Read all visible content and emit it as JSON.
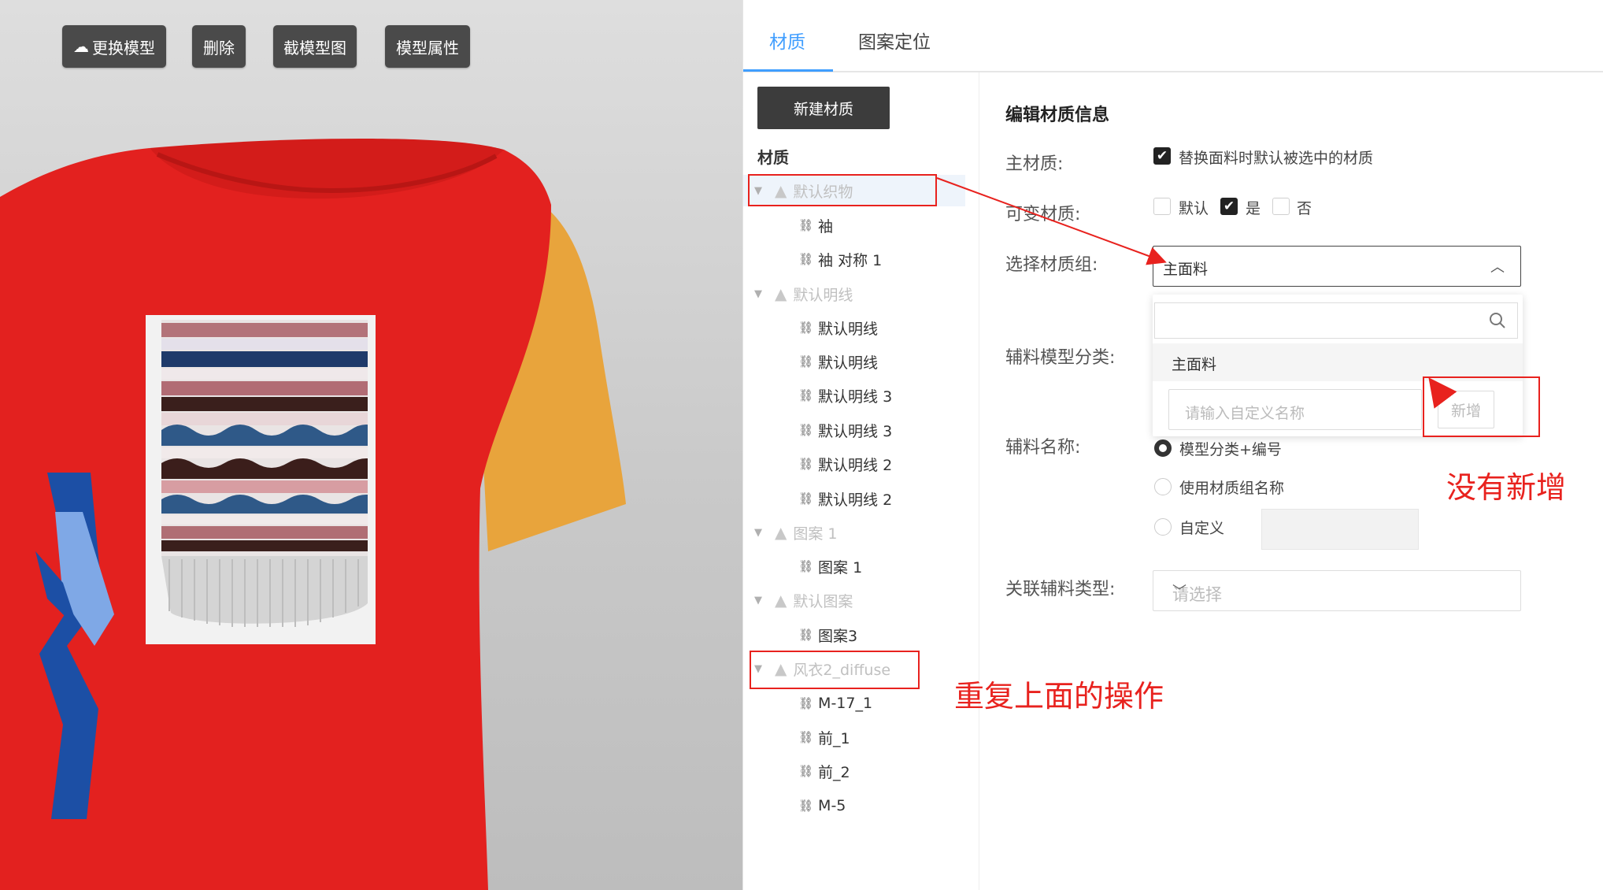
{
  "viewport": {
    "toolbar": [
      {
        "label": "更换模型",
        "icon": "cloud-icon"
      },
      {
        "label": "删除"
      },
      {
        "label": "截模型图"
      },
      {
        "label": "模型属性"
      }
    ],
    "colors": {
      "shirt": "#e3211f",
      "sleeve": "#e8a43c",
      "stripe_dark": "#1c4fa5",
      "stripe_light": "#7fa8e6"
    }
  },
  "tabs": [
    {
      "label": "材质",
      "active": true
    },
    {
      "label": "图案定位",
      "active": false
    }
  ],
  "tree": {
    "new_button": "新建材质",
    "title": "材质",
    "groups": [
      {
        "label": "默认织物",
        "children": [
          "袖",
          "袖 对称 1"
        ]
      },
      {
        "label": "默认明线",
        "children": [
          "默认明线",
          "默认明线",
          "默认明线 3",
          "默认明线 3",
          "默认明线 2",
          "默认明线 2"
        ]
      },
      {
        "label": "图案 1",
        "children": [
          "图案 1"
        ]
      },
      {
        "label": "默认图案",
        "children": [
          "图案3"
        ]
      },
      {
        "label": "风衣2_diffuse",
        "children": [
          "M-17_1",
          "前_1",
          "前_2",
          "M-5"
        ]
      }
    ]
  },
  "form": {
    "title": "编辑材质信息",
    "main_material": {
      "label": "主材质:",
      "checkbox_text": "替换面料时默认被选中的材质",
      "checked": true
    },
    "variable_material": {
      "label": "可变材质:",
      "options": [
        {
          "text": "默认",
          "checked": false
        },
        {
          "text": "是",
          "checked": true
        },
        {
          "text": "否",
          "checked": false
        }
      ]
    },
    "material_group": {
      "label": "选择材质组:",
      "value": "主面料"
    },
    "dropdown": {
      "search_placeholder": "",
      "item": "主面料",
      "custom_placeholder": "请输入自定义名称",
      "add_button": "新增"
    },
    "accessory_category": {
      "label": "辅料模型分类:"
    },
    "accessory_name": {
      "label": "辅料名称:",
      "options": [
        {
          "text": "模型分类+编号",
          "selected": true
        },
        {
          "text": "使用材质组名称",
          "selected": false
        },
        {
          "text": "自定义",
          "selected": false
        }
      ]
    },
    "linked_type": {
      "label": "关联辅料类型:",
      "placeholder": "请选择"
    }
  },
  "annotations": {
    "no_add": "没有新增",
    "repeat": "重复上面的操作",
    "color": "#e8221e"
  }
}
